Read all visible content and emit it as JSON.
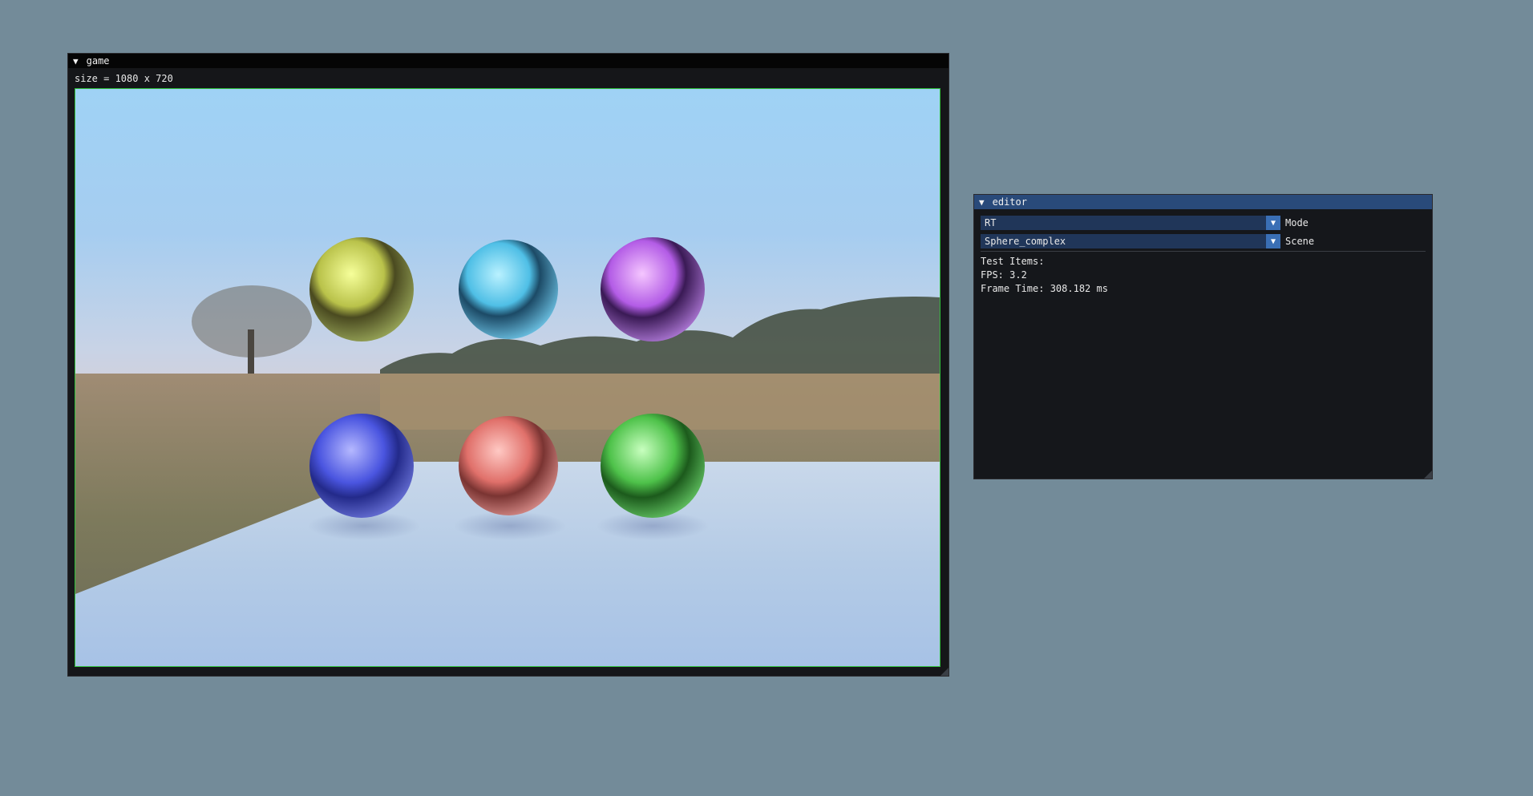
{
  "game_window": {
    "title": "game",
    "size_label": "size = 1080 x 720"
  },
  "editor_window": {
    "title": "editor",
    "mode": {
      "value": "RT",
      "label": "Mode"
    },
    "scene": {
      "value": "Sphere_complex",
      "label": "Scene"
    },
    "info": {
      "test_items": "Test Items:",
      "fps": "FPS: 3.2",
      "frame_time": "Frame Time: 308.182 ms"
    }
  },
  "icons": {
    "collapse": "collapse-triangle-icon",
    "dropdown": "dropdown-arrow-icon"
  },
  "colors": {
    "background": "#738b99",
    "viewport_border": "#2fbf3a",
    "editor_title": "#294a7a",
    "combo_bg": "#203659",
    "combo_arrow": "#3a6fb5"
  }
}
